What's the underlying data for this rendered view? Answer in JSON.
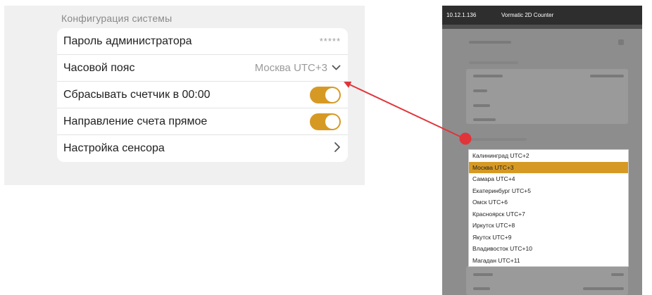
{
  "settings": {
    "section_title": "Конфигурация системы",
    "rows": [
      {
        "label": "Пароль администратора",
        "value": "*****",
        "control": "masked"
      },
      {
        "label": "Часовой пояс",
        "value": "Москва UTC+3",
        "control": "dropdown",
        "icon": "chevron-down-icon"
      },
      {
        "label": "Сбрасывать счетчик в 00:00",
        "control": "toggle",
        "on": true
      },
      {
        "label": "Направление счета прямое",
        "control": "toggle",
        "on": true
      },
      {
        "label": "Настройка сенсора",
        "control": "link",
        "icon": "chevron-right-icon"
      }
    ]
  },
  "phone": {
    "status_ip": "10.12.1.136",
    "app_title": "Vormatic 2D Counter",
    "timezone_options": [
      "Калининград UTC+2",
      "Москва UTC+3",
      "Самара UTC+4",
      "Екатеринбург UTC+5",
      "Омск UTC+6",
      "Красноярск UTC+7",
      "Иркутск UTC+8",
      "Якутск UTC+9",
      "Владивосток UTC+10",
      "Магадан UTC+11"
    ],
    "selected_option": "Москва UTC+3"
  },
  "colors": {
    "accent": "#d69a24",
    "arrow": "#e0343a",
    "panel_bg": "#f0f0f0"
  }
}
